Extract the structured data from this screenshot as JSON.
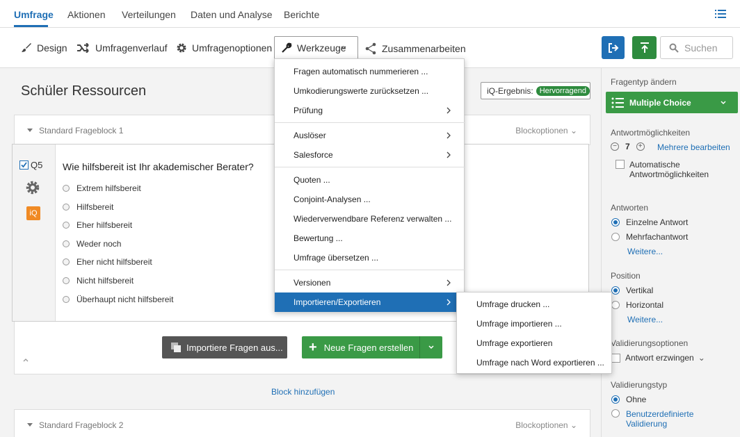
{
  "topnav": {
    "tabs": [
      "Umfrage",
      "Aktionen",
      "Verteilungen",
      "Daten und Analyse",
      "Berichte"
    ]
  },
  "toolbar": {
    "design": "Design",
    "history": "Umfragenverlauf",
    "options": "Umfragenoptionen",
    "tools": "Werkzeuge",
    "collaborate": "Zusammenarbeiten",
    "search_placeholder": "Suchen"
  },
  "survey": {
    "title": "Schüler Ressourcen",
    "iq_label": "iQ-Ergebnis:",
    "iq_value": "Hervorragend"
  },
  "block1": {
    "title": "Standard Frageblock 1",
    "options": "Blockoptionen"
  },
  "question": {
    "id": "Q5",
    "text": "Wie hilfsbereit ist Ihr akademischer Berater?",
    "iq_badge": "iQ",
    "choices": [
      "Extrem hilfsbereit",
      "Hilfsbereit",
      "Eher hilfsbereit",
      "Weder noch",
      "Eher nicht hilfsbereit",
      "Nicht hilfsbereit",
      "Überhaupt nicht hilfsbereit"
    ]
  },
  "actions": {
    "import": "Importiere Fragen aus...",
    "new": "Neue Fragen erstellen",
    "add_block": "Block hinzufügen"
  },
  "block2": {
    "title": "Standard Frageblock 2",
    "options": "Blockoptionen"
  },
  "menu": {
    "items": [
      "Fragen automatisch nummerieren ...",
      "Umkodierungswerte zurücksetzen ...",
      "Prüfung",
      "Auslöser",
      "Salesforce",
      "Quoten ...",
      "Conjoint-Analysen ...",
      "Wiederverwendbare Referenz verwalten ...",
      "Bewertung ...",
      "Umfrage übersetzen ...",
      "Versionen",
      "Importieren/Exportieren"
    ],
    "active": "Importieren/Exportieren"
  },
  "submenu": {
    "items": [
      "Umfrage drucken ...",
      "Umfrage importieren ...",
      "Umfrage exportieren",
      "Umfrage nach Word exportieren ..."
    ]
  },
  "panel": {
    "type_heading": "Fragentyp ändern",
    "type_value": "Multiple Choice",
    "choices_heading": "Antwortmöglichkeiten",
    "choices_count": "7",
    "edit_multiple": "Mehrere bearbeiten",
    "auto_choices_1": "Automatische",
    "auto_choices_2": "Antwortmöglichkeiten",
    "answers_heading": "Antworten",
    "single": "Einzelne Antwort",
    "multiple": "Mehrfachantwort",
    "more1": "Weitere...",
    "position_heading": "Position",
    "vertical": "Vertikal",
    "horizontal": "Horizontal",
    "more2": "Weitere...",
    "validation_heading": "Validierungsoptionen",
    "force": "Antwort erzwingen",
    "validation_type_heading": "Validierungstyp",
    "none": "Ohne",
    "custom_1": "Benutzerdefinierte",
    "custom_2": "Validierung"
  },
  "colors": {
    "accent": "#1f6fb5",
    "green": "#3a9a46"
  }
}
